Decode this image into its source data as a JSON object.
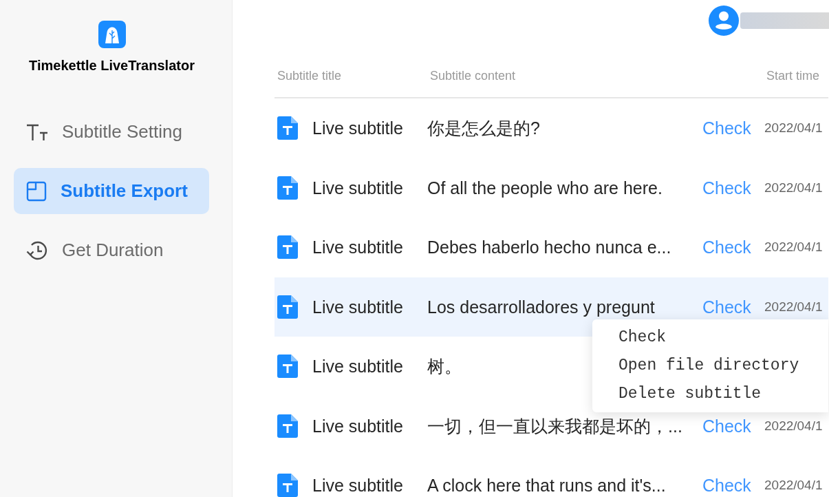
{
  "app": {
    "name": "Timekettle LiveTranslator"
  },
  "sidebar": {
    "items": [
      {
        "kind": "textsize",
        "label": "Subtitle Setting",
        "selected": false
      },
      {
        "kind": "export",
        "label": "Subtitle Export",
        "selected": true
      },
      {
        "kind": "history",
        "label": "Get Duration",
        "selected": false
      }
    ]
  },
  "table": {
    "columns": [
      "Subtitle title",
      "Subtitle content",
      "Start time"
    ],
    "rows": [
      {
        "title": "Live subtitle",
        "content": "你是怎么是的?",
        "action": "Check",
        "start_time": "2022/04/1",
        "selected": false
      },
      {
        "title": "Live subtitle",
        "content": "Of all the people who are here.",
        "action": "Check",
        "start_time": "2022/04/1",
        "selected": false
      },
      {
        "title": "Live subtitle",
        "content": "Debes haberlo hecho nunca e...",
        "action": "Check",
        "start_time": "2022/04/1",
        "selected": false
      },
      {
        "title": "Live subtitle",
        "content": "Los desarrolladores y pregunt",
        "action": "Check",
        "start_time": "2022/04/1",
        "selected": true
      },
      {
        "title": "Live subtitle",
        "content": "树。",
        "selected": false
      },
      {
        "title": "Live subtitle",
        "content": "一切，但一直以来我都是坏的，...",
        "action": "Check",
        "start_time": "2022/04/1",
        "selected": false
      },
      {
        "title": "Live subtitle",
        "content": "A clock here that runs and it's...",
        "action": "Check",
        "start_time": "2022/04/1",
        "selected": false
      }
    ]
  },
  "context_menu": {
    "items": [
      "Check",
      "Open file directory",
      "Delete subtitle"
    ]
  }
}
